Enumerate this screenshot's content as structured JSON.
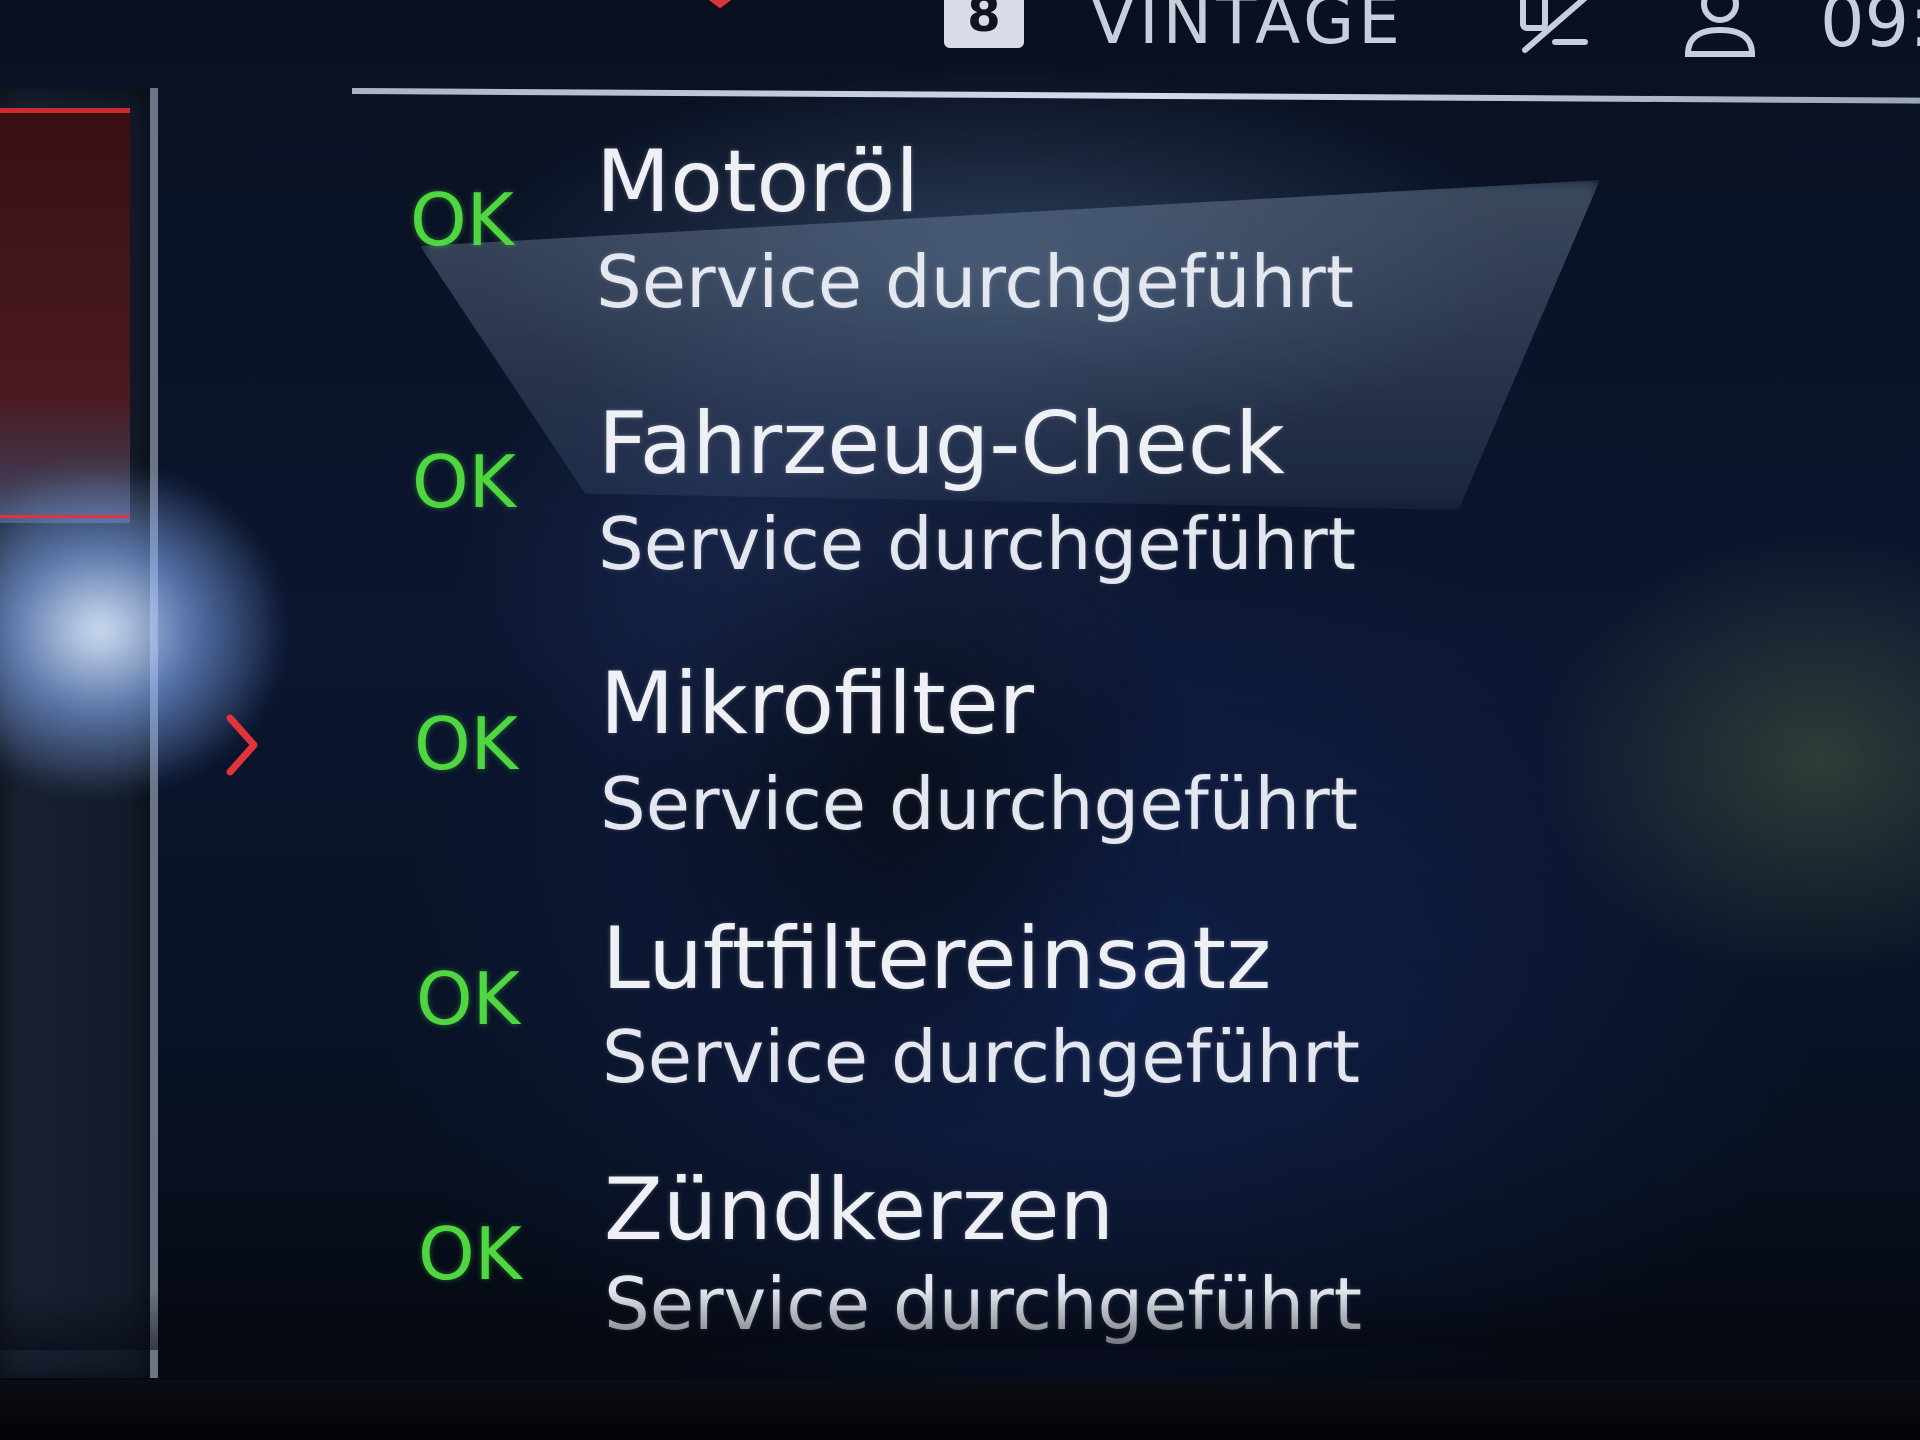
{
  "status_bar": {
    "gear": "8",
    "drive_mode": "VINTAGE",
    "clock": "09:"
  },
  "colors": {
    "ok_green": "#4fd640",
    "text_white": "#eef0f6",
    "accent_red": "#e0343a",
    "background": "#0b1630"
  },
  "icons": {
    "close": "close-icon",
    "phone": "phone-icon",
    "profile": "profile-icon",
    "selection": "chevron-right-icon"
  },
  "service_items": [
    {
      "status_code": "OK",
      "title": "Motoröl",
      "status": "Service durchgeführt"
    },
    {
      "status_code": "OK",
      "title": "Fahrzeug-Check",
      "status": "Service durchgeführt"
    },
    {
      "status_code": "OK",
      "title": "Mikrofilter",
      "status": "Service durchgeführt"
    },
    {
      "status_code": "OK",
      "title": "Luftfiltereinsatz",
      "status": "Service durchgeführt"
    },
    {
      "status_code": "OK",
      "title": "Zündkerzen",
      "status": "Service durchgeführt"
    }
  ]
}
